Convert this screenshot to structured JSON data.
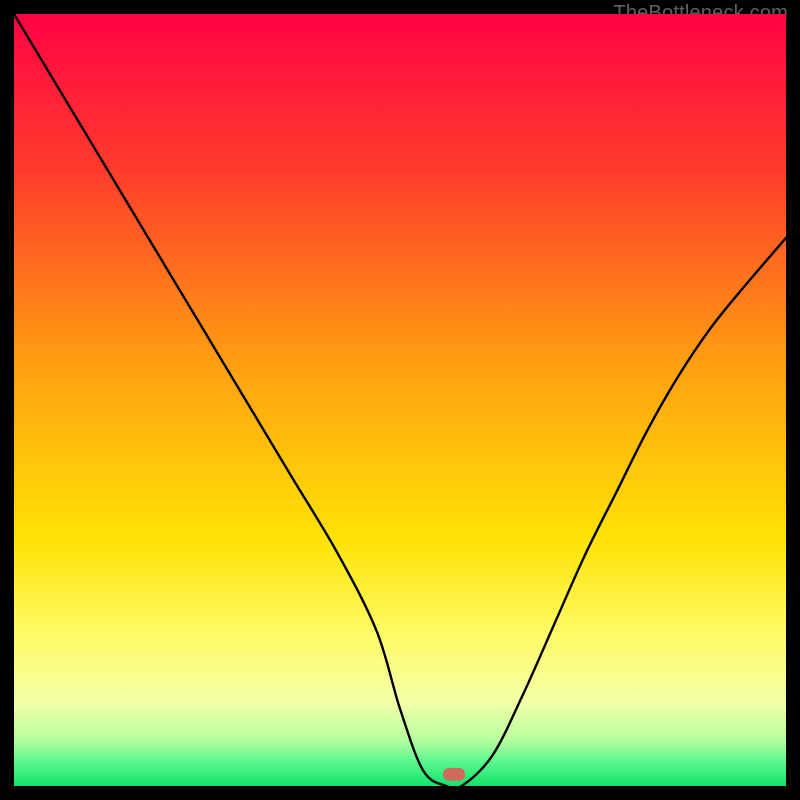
{
  "watermark": "TheBottleneck.com",
  "chart_data": {
    "type": "line",
    "title": "",
    "xlabel": "",
    "ylabel": "",
    "xlim": [
      0,
      100
    ],
    "ylim": [
      0,
      100
    ],
    "grid": false,
    "legend": false,
    "gradient_stops": [
      {
        "offset": 0,
        "color": "#ff0344"
      },
      {
        "offset": 20,
        "color": "#ff3b2c"
      },
      {
        "offset": 45,
        "color": "#ff9e12"
      },
      {
        "offset": 68,
        "color": "#ffe205"
      },
      {
        "offset": 80,
        "color": "#fffb64"
      },
      {
        "offset": 89,
        "color": "#f4ffa7"
      },
      {
        "offset": 94,
        "color": "#b7ff9f"
      },
      {
        "offset": 97,
        "color": "#57f68f"
      },
      {
        "offset": 100,
        "color": "#12e468"
      }
    ],
    "series": [
      {
        "name": "bottleneck-curve",
        "x": [
          0,
          6,
          12,
          18,
          24,
          30,
          36,
          42,
          47,
          50,
          53,
          56,
          58,
          62,
          66,
          70,
          74,
          78,
          82,
          86,
          90,
          94,
          100
        ],
        "y": [
          100,
          90,
          80,
          70,
          60,
          50,
          40,
          30,
          20,
          10,
          2,
          0,
          0,
          4,
          12,
          21,
          30,
          38,
          46,
          53,
          59,
          64,
          71
        ]
      }
    ],
    "marker": {
      "x": 57,
      "y": 1.5,
      "color": "#cf6a5e",
      "shape": "rounded-rect"
    }
  }
}
